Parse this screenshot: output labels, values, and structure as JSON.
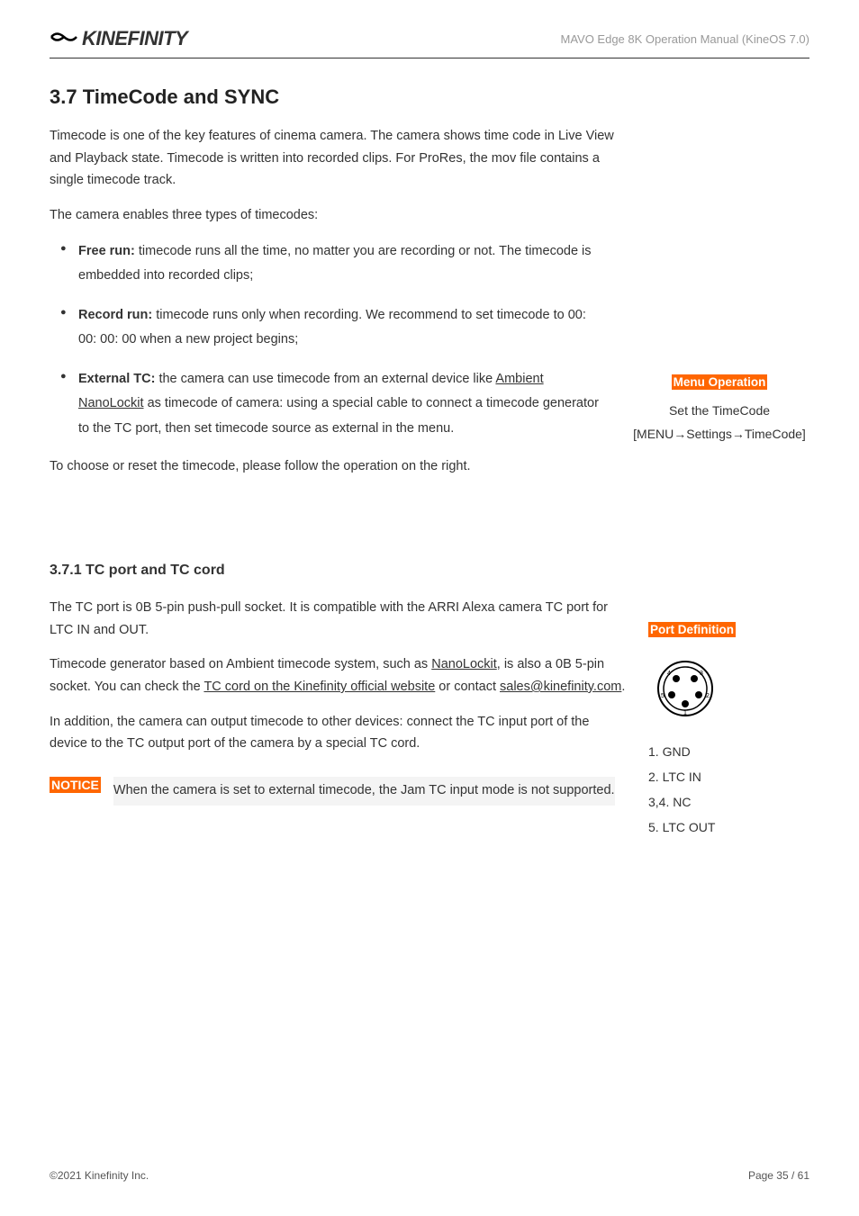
{
  "header": {
    "logo_text": "KINEFINITY",
    "subtitle": "MAVO Edge 8K Operation Manual (KineOS 7.0)"
  },
  "section": {
    "title": "3.7 TimeCode and SYNC",
    "intro_p1": "Timecode is one of the key features of cinema camera. The camera shows time code in Live View and Playback state. Timecode is written into recorded clips. For ProRes, the mov file contains a single timecode track.",
    "intro_p2": "The camera enables three types of timecodes:",
    "bullets": [
      {
        "label": "Free run:",
        "text": " timecode runs all the time, no matter you are recording or not. The timecode is embedded into recorded clips;"
      },
      {
        "label": "Record run:",
        "text": " timecode runs only when recording. We recommend to set timecode to 00: 00: 00: 00 when a new project begins;"
      },
      {
        "label": "External TC:",
        "text_before_link": " the camera can use timecode from an external device like ",
        "link": "Ambient NanoLockit",
        "text_after_link": " as timecode of camera: using a special cable to connect a timecode generator to the TC port, then set timecode source as external in the menu."
      }
    ],
    "after_bullets": "To choose or reset the timecode, please follow the operation on the right."
  },
  "sidebar_menu": {
    "label": "Menu Operation",
    "line1": "Set the TimeCode",
    "line2": "[MENU→Settings→TimeCode]"
  },
  "subsection": {
    "title": "3.7.1 TC port and TC cord",
    "p1": "The TC port is 0B 5-pin push-pull socket. It is compatible with the ARRI Alexa camera TC port for LTC IN and OUT.",
    "p2_before": "Timecode generator based on Ambient timecode system, such as ",
    "p2_link1": "NanoLockit",
    "p2_mid1": ", is also a 0B 5-pin socket. You can check the ",
    "p2_link2": "TC cord on the Kinefinity official website",
    "p2_mid2": " or contact ",
    "p2_link3": "sales@kinefinity.com",
    "p2_after": ".",
    "p3": "In addition, the camera can output timecode to other devices: connect the TC input port of the device to the TC output port of the camera by a special TC cord."
  },
  "port_sidebar": {
    "label": "Port Definition",
    "pins": {
      "p1": "1. GND",
      "p2": "2. LTC IN",
      "p3": "3,4. NC",
      "p5": "5. LTC OUT"
    }
  },
  "notice": {
    "badge": "NOTICE",
    "text": "When the camera is set to external timecode, the Jam TC input mode is not supported."
  },
  "footer": {
    "copyright": "©2021 Kinefinity Inc.",
    "page": "Page 35 / 61"
  }
}
